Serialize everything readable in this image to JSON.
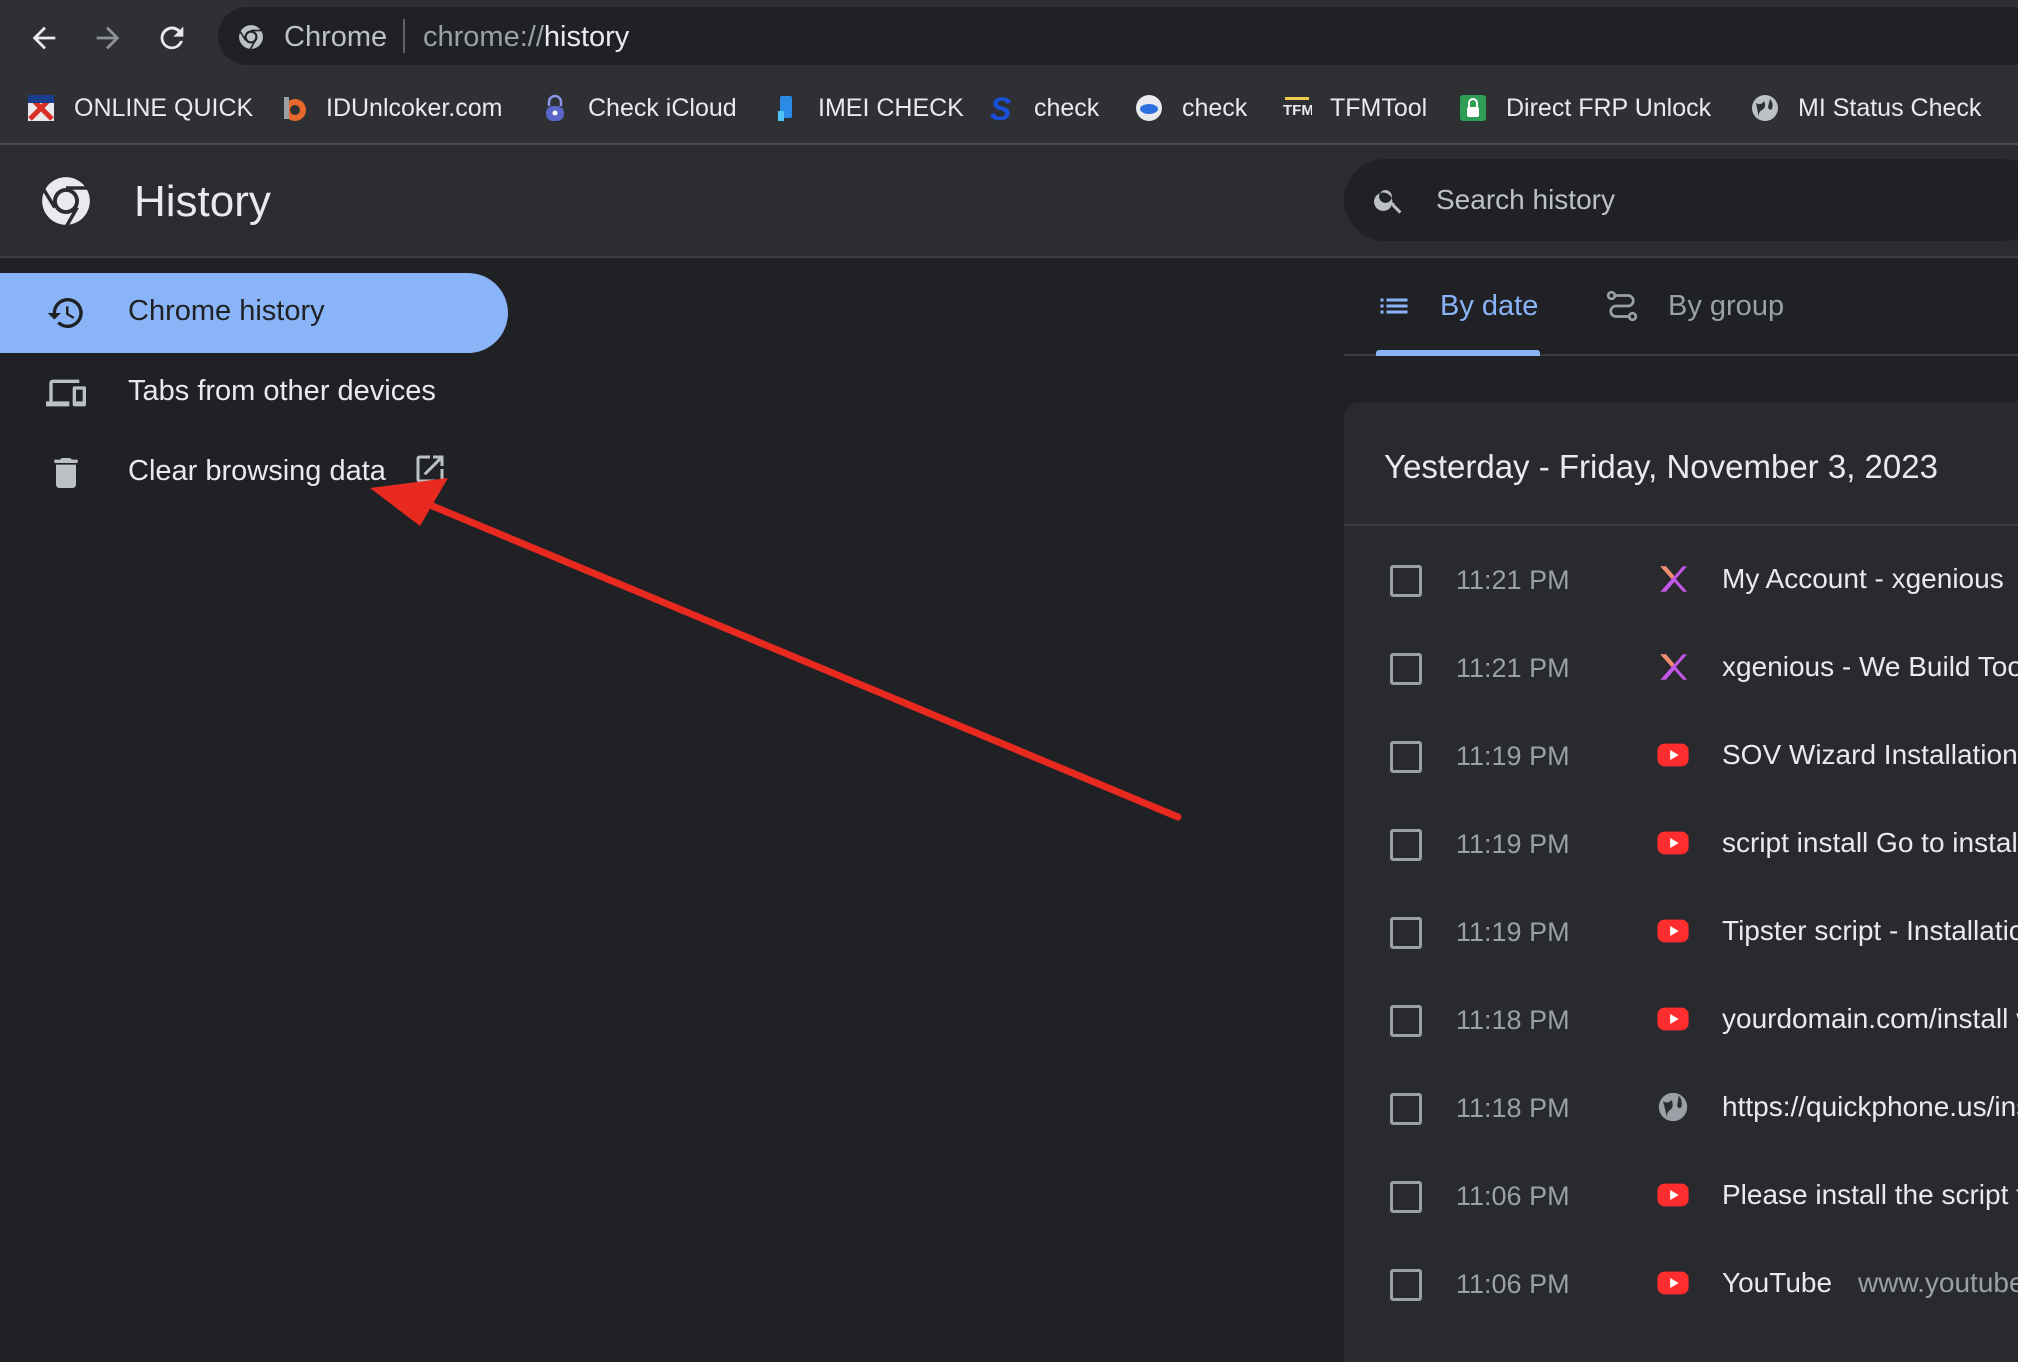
{
  "browser": {
    "site_name": "Chrome",
    "url_scheme": "chrome://",
    "url_path": "history"
  },
  "bookmarks": [
    {
      "label": "ONLINE QUICK",
      "icon": "online-quick-icon"
    },
    {
      "label": "IDUnlcoker.com",
      "icon": "idunlocker-icon"
    },
    {
      "label": "Check iCloud",
      "icon": "lock-icon"
    },
    {
      "label": "IMEI CHECK",
      "icon": "imei-icon"
    },
    {
      "label": "check",
      "icon": "s-logo-icon"
    },
    {
      "label": "check",
      "icon": "cloud-icon"
    },
    {
      "label": "TFMTool",
      "icon": "tfm-icon"
    },
    {
      "label": "Direct FRP Unlock",
      "icon": "frp-lock-icon"
    },
    {
      "label": "MI Status Check",
      "icon": "globe-icon"
    }
  ],
  "header": {
    "title": "History",
    "search_placeholder": "Search history"
  },
  "sidebar": {
    "items": [
      {
        "label": "Chrome history",
        "icon": "history-clock-icon",
        "active": true
      },
      {
        "label": "Tabs from other devices",
        "icon": "devices-icon",
        "active": false
      },
      {
        "label": "Clear browsing data",
        "icon": "trash-icon",
        "active": false,
        "external": "open-in-new-icon"
      }
    ]
  },
  "tabs": [
    {
      "label": "By date",
      "icon": "list-icon",
      "selected": true
    },
    {
      "label": "By group",
      "icon": "journeys-icon",
      "selected": false
    }
  ],
  "results": {
    "date_heading": "Yesterday - Friday, November 3, 2023",
    "rows": [
      {
        "time": "11:21 PM",
        "favicon": "xgenious-icon",
        "title": "My Account - xgenious",
        "domain": ""
      },
      {
        "time": "11:21 PM",
        "favicon": "xgenious-icon",
        "title": "xgenious - We Build Tool",
        "domain": ""
      },
      {
        "time": "11:19 PM",
        "favicon": "youtube-icon",
        "title": "SOV Wizard Installation",
        "domain": ""
      },
      {
        "time": "11:19 PM",
        "favicon": "youtube-icon",
        "title": "script install Go to install",
        "domain": ""
      },
      {
        "time": "11:19 PM",
        "favicon": "youtube-icon",
        "title": "Tipster script - Installatic",
        "domain": ""
      },
      {
        "time": "11:18 PM",
        "favicon": "youtube-icon",
        "title": "yourdomain.com/install v",
        "domain": ""
      },
      {
        "time": "11:18 PM",
        "favicon": "globe-icon",
        "title": "https://quickphone.us/ins",
        "domain": ""
      },
      {
        "time": "11:06 PM",
        "favicon": "youtube-icon",
        "title": "Please install the script f",
        "domain": ""
      },
      {
        "time": "11:06 PM",
        "favicon": "youtube-icon",
        "title": "YouTube",
        "domain": "www.youtube"
      }
    ]
  },
  "colors": {
    "accent": "#8ab4f8",
    "background": "#202124",
    "annotation_arrow": "#e8291f"
  }
}
